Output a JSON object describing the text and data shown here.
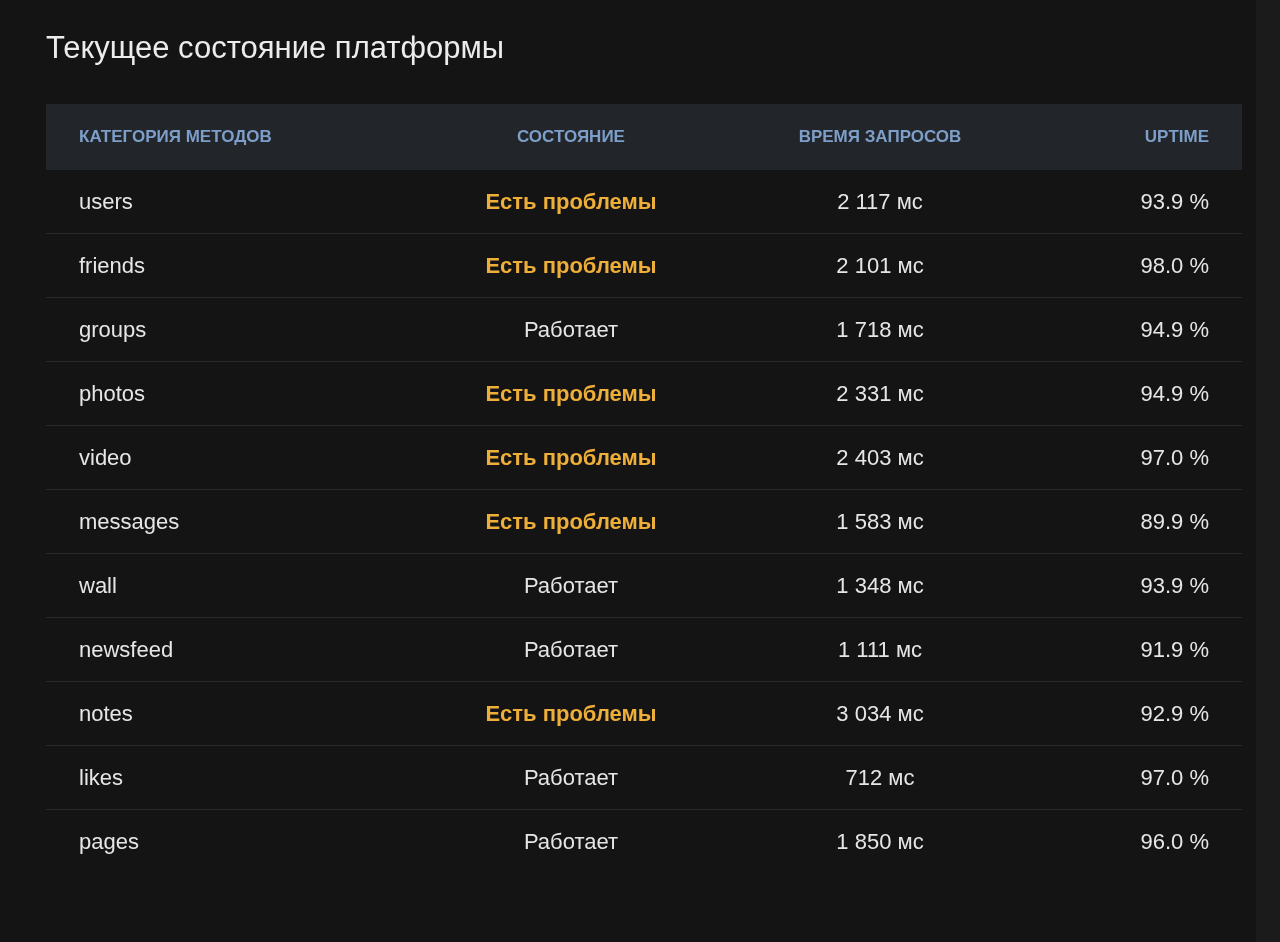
{
  "title": "Текущее состояние платформы",
  "table": {
    "columns": [
      "КАТЕГОРИЯ МЕТОДОВ",
      "СОСТОЯНИЕ",
      "ВРЕМЯ ЗАПРОСОВ",
      "UPTIME"
    ],
    "rows": [
      {
        "category": "users",
        "status": "Есть проблемы",
        "kind": "problem",
        "time": "2 117 мс",
        "uptime": "93.9 %"
      },
      {
        "category": "friends",
        "status": "Есть проблемы",
        "kind": "problem",
        "time": "2 101 мс",
        "uptime": "98.0 %"
      },
      {
        "category": "groups",
        "status": "Работает",
        "kind": "ok",
        "time": "1 718 мс",
        "uptime": "94.9 %"
      },
      {
        "category": "photos",
        "status": "Есть проблемы",
        "kind": "problem",
        "time": "2 331 мс",
        "uptime": "94.9 %"
      },
      {
        "category": "video",
        "status": "Есть проблемы",
        "kind": "problem",
        "time": "2 403 мс",
        "uptime": "97.0 %"
      },
      {
        "category": "messages",
        "status": "Есть проблемы",
        "kind": "problem",
        "time": "1 583 мс",
        "uptime": "89.9 %"
      },
      {
        "category": "wall",
        "status": "Работает",
        "kind": "ok",
        "time": "1 348 мс",
        "uptime": "93.9 %"
      },
      {
        "category": "newsfeed",
        "status": "Работает",
        "kind": "ok",
        "time": "1 111 мс",
        "uptime": "91.9 %"
      },
      {
        "category": "notes",
        "status": "Есть проблемы",
        "kind": "problem",
        "time": "3 034 мс",
        "uptime": "92.9 %"
      },
      {
        "category": "likes",
        "status": "Работает",
        "kind": "ok",
        "time": "712 мс",
        "uptime": "97.0 %"
      },
      {
        "category": "pages",
        "status": "Работает",
        "kind": "ok",
        "time": "1 850 мс",
        "uptime": "96.0 %"
      }
    ]
  }
}
